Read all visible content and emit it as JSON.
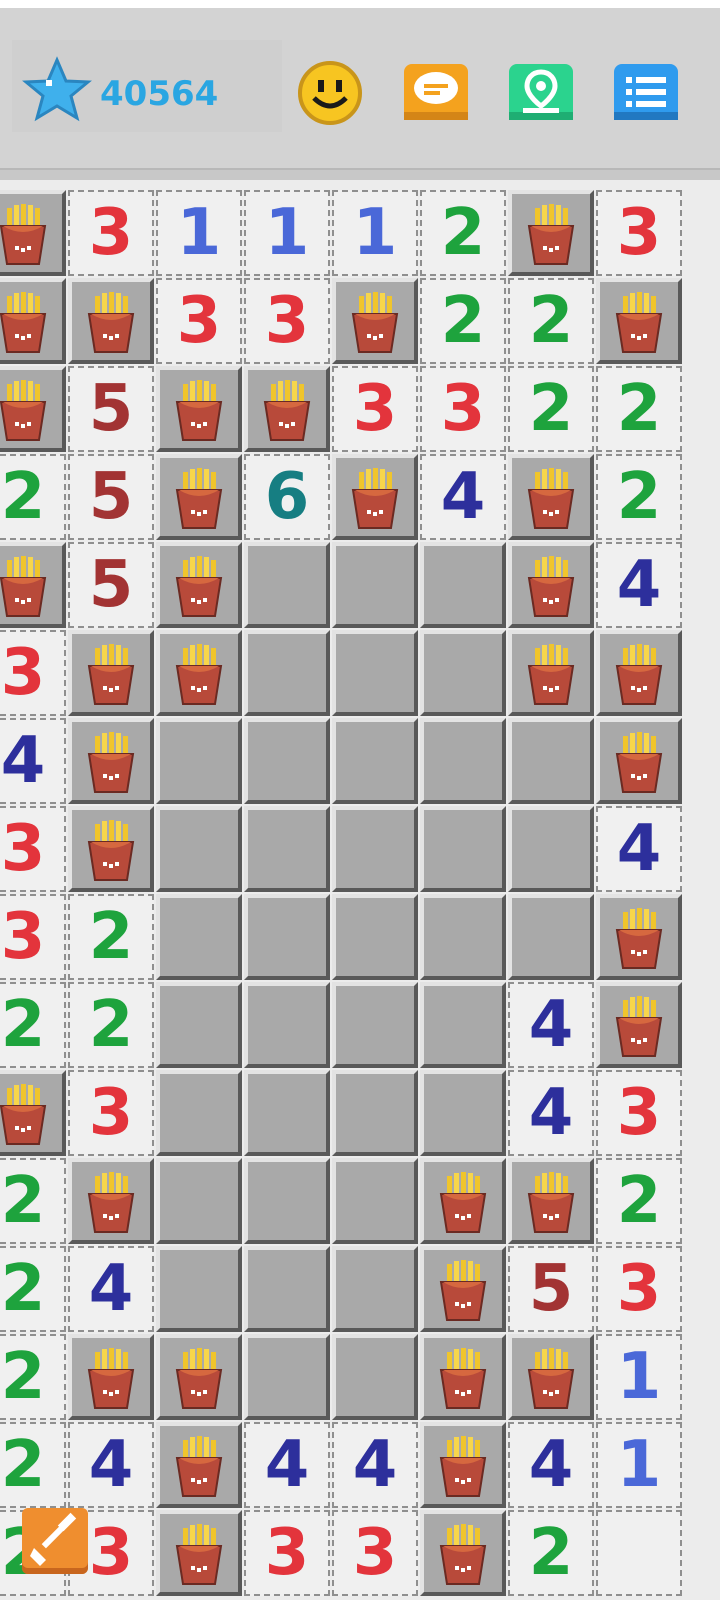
{
  "header": {
    "score": "40564",
    "icons": [
      "star-icon",
      "smiley-face-icon",
      "chat-bubble-icon",
      "map-pin-icon",
      "menu-list-icon"
    ]
  },
  "colors": {
    "1": "#4a68d8",
    "2": "#1ea33d",
    "3": "#e3343c",
    "4": "#2d2f9c",
    "5": "#a23333",
    "6": "#167e82"
  },
  "board": {
    "rows": [
      [
        "F",
        "3",
        "1",
        "1",
        "1",
        "2",
        "F",
        "3"
      ],
      [
        "F",
        "F",
        "3",
        "3",
        "F",
        "2",
        "2",
        "F"
      ],
      [
        "F",
        "5",
        "F",
        "F",
        "3",
        "3",
        "2",
        "2"
      ],
      [
        "2",
        "5",
        "F",
        "6",
        "F",
        "4",
        "F",
        "2"
      ],
      [
        "F",
        "5",
        "F",
        "C",
        "C",
        "C",
        "F",
        "4"
      ],
      [
        "3",
        "F",
        "F",
        "C",
        "C",
        "C",
        "F",
        "F"
      ],
      [
        "4",
        "F",
        "C",
        "C",
        "C",
        "C",
        "C",
        "F"
      ],
      [
        "3",
        "F",
        "C",
        "C",
        "C",
        "C",
        "C",
        "4"
      ],
      [
        "3",
        "2",
        "C",
        "C",
        "C",
        "C",
        "C",
        "F"
      ],
      [
        "2",
        "2",
        "C",
        "C",
        "C",
        "C",
        "4",
        "F"
      ],
      [
        "F",
        "3",
        "C",
        "C",
        "C",
        "C",
        "4",
        "3"
      ],
      [
        "2",
        "F",
        "C",
        "C",
        "C",
        "F",
        "F",
        "2"
      ],
      [
        "2",
        "4",
        "C",
        "C",
        "C",
        "F",
        "5",
        "3"
      ],
      [
        "2",
        "F",
        "F",
        "C",
        "C",
        "F",
        "F",
        "1"
      ],
      [
        "2",
        "4",
        "F",
        "4",
        "4",
        "F",
        "4",
        "1"
      ],
      [
        "2",
        "3",
        "F",
        "3",
        "3",
        "F",
        "2",
        ""
      ]
    ]
  },
  "tools": {
    "shovel": "shovel-icon"
  }
}
